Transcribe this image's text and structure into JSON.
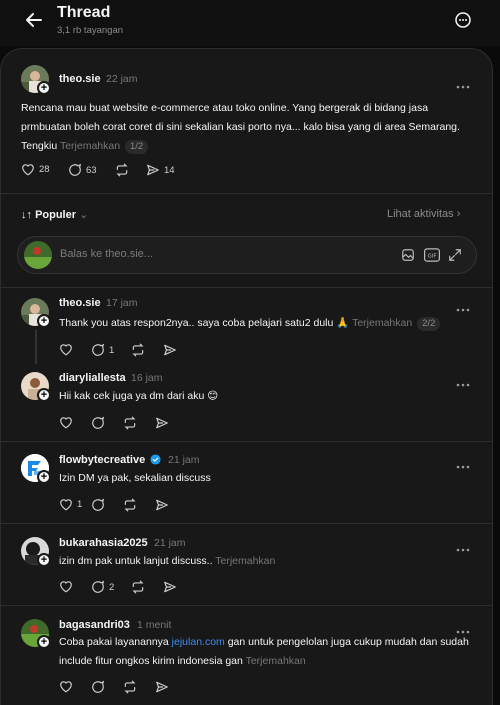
{
  "header": {
    "title": "Thread",
    "views": "3,1 rb tayangan"
  },
  "post": {
    "username": "theo.sie",
    "time": "22 jam",
    "text": "Rencana mau buat website e-commerce atau toko online. Yang bergerak di bidang jasa prmbuatan boleh corat coret di sini sekalian kasi porto nya... kalo bisa yang di area Semarang. Tengkiu",
    "translate": "Terjemahkan",
    "pager": "1/2",
    "likes": "28",
    "comments": "63",
    "shares": "14"
  },
  "sort": {
    "label": "Populer",
    "activity": "Lihat aktivitas"
  },
  "reply_box": {
    "placeholder": "Balas ke theo.sie..."
  },
  "replies": [
    {
      "username": "theo.sie",
      "time": "17 jam",
      "text": "Thank you atas respon2nya.. saya coba pelajari satu2 dulu 🙏",
      "translate": "Terjemahkan",
      "pager": "2/2",
      "comments": "1"
    },
    {
      "username": "diaryliallesta",
      "time": "16 jam",
      "text": "Hii kak cek juga ya dm dari aku 😊"
    },
    {
      "username": "flowbytecreative",
      "time": "21 jam",
      "text": "Izin DM ya pak, sekalian discuss",
      "likes": "1",
      "verified": true
    },
    {
      "username": "bukarahasia2025",
      "time": "21 jam",
      "text": "izin dm pak untuk lanjut discuss..",
      "translate": "Terjemahkan",
      "comments": "2"
    },
    {
      "username": "bagasandri03",
      "time": "1 menit",
      "text_a": "Coba pakai layanannya ",
      "link": "jejulan.com",
      "text_b": " gan untuk pengelolan juga cukup mudah dan sudah include fitur ongkos kirim indonesia gan",
      "translate": "Terjemahkan"
    }
  ],
  "colors": {
    "background": "#0a0a0a",
    "panel": "#181818",
    "link": "#3d8cf0",
    "verified": "#1d9bf0"
  }
}
